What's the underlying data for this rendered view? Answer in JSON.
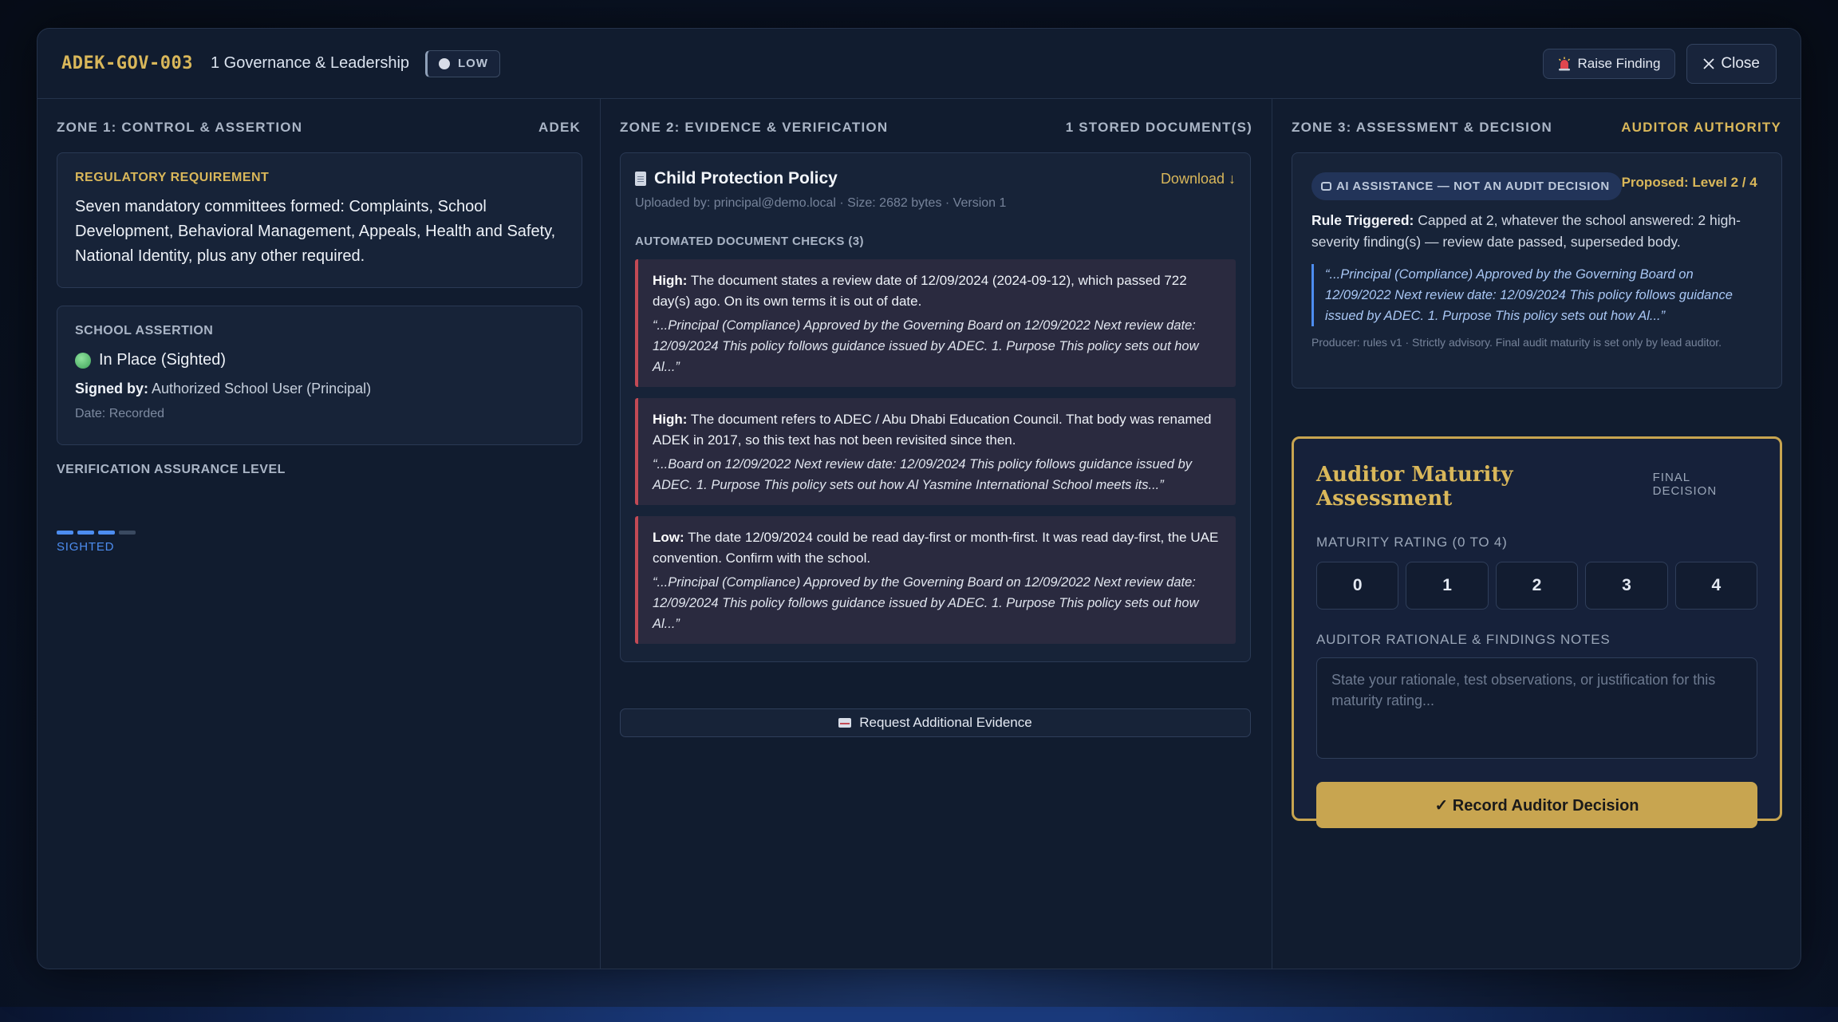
{
  "header": {
    "control_id": "ADEK-GOV-003",
    "category": "1 Governance & Leadership",
    "risk_level": "LOW",
    "raise_finding_label": "Raise Finding",
    "close_label": "Close"
  },
  "zone1": {
    "title": "ZONE 1: CONTROL & ASSERTION",
    "tag": "ADEK",
    "requirement_label": "REGULATORY REQUIREMENT",
    "requirement_text": "Seven mandatory committees formed: Complaints, School Development, Behavioral Management, Appeals, Health and Safety, National Identity, plus any other required.",
    "assertion_label": "SCHOOL ASSERTION",
    "assertion_status": "In Place (Sighted)",
    "signed_by_label": "Signed by:",
    "signed_by_value": "Authorized School User (Principal)",
    "date_text": "Date: Recorded",
    "verification_label": "VERIFICATION ASSURANCE LEVEL",
    "verification_level": "SIGHTED",
    "verification_score": 3,
    "verification_max": 4
  },
  "zone2": {
    "title": "ZONE 2: EVIDENCE & VERIFICATION",
    "tag": "1 STORED DOCUMENT(S)",
    "document": {
      "name": "Child Protection Policy",
      "download_label": "Download ↓",
      "meta": "Uploaded by: principal@demo.local · Size: 2682 bytes · Version 1"
    },
    "checks_label": "AUTOMATED DOCUMENT CHECKS (3)",
    "findings": [
      {
        "severity": "High:",
        "text": "The document states a review date of 12/09/2024 (2024-09-12), which passed 722 day(s) ago. On its own terms it is out of date.",
        "quote": "“...Principal (Compliance) Approved by the Governing Board on 12/09/2022 Next review date: 12/09/2024 This policy follows guidance issued by ADEC. 1. Purpose This policy sets out how Al...”"
      },
      {
        "severity": "High:",
        "text": "The document refers to ADEC / Abu Dhabi Education Council. That body was renamed ADEK in 2017, so this text has not been revisited since then.",
        "quote": "“...Board on 12/09/2022 Next review date: 12/09/2024 This policy follows guidance issued by ADEC. 1. Purpose This policy sets out how Al Yasmine International School meets its...”"
      },
      {
        "severity": "Low:",
        "text": "The date 12/09/2024 could be read day-first or month-first. It was read day-first, the UAE convention. Confirm with the school.",
        "quote": "“...Principal (Compliance) Approved by the Governing Board on 12/09/2022 Next review date: 12/09/2024 This policy follows guidance issued by ADEC. 1. Purpose This policy sets out how Al...”"
      }
    ],
    "request_label": "Request Additional Evidence"
  },
  "zone3": {
    "title": "ZONE 3: ASSESSMENT & DECISION",
    "tag": "AUDITOR AUTHORITY",
    "ai_label": "AI ASSISTANCE — NOT AN AUDIT DECISION",
    "proposed": "Proposed: Level 2 / 4",
    "rule_label": "Rule Triggered:",
    "rule_text": "Capped at 2, whatever the school answered: 2 high-severity finding(s) — review date passed, superseded body.",
    "ai_quote": "“...Principal (Compliance) Approved by the Governing Board on 12/09/2022 Next review date: 12/09/2024 This policy follows guidance issued by ADEC. 1. Purpose This policy sets out how Al...”",
    "producer": "Producer: rules v1 · Strictly advisory. Final audit maturity is set only by lead auditor.",
    "assessment_title": "Auditor Maturity Assessment",
    "final_decision": "FINAL DECISION",
    "rating_label": "MATURITY RATING (0 TO 4)",
    "ratings": [
      "0",
      "1",
      "2",
      "3",
      "4"
    ],
    "notes_label": "AUDITOR RATIONALE & FINDINGS NOTES",
    "notes_placeholder": "State your rationale, test observations, or justification for this maturity rating...",
    "record_label": "✓ Record Auditor Decision"
  }
}
